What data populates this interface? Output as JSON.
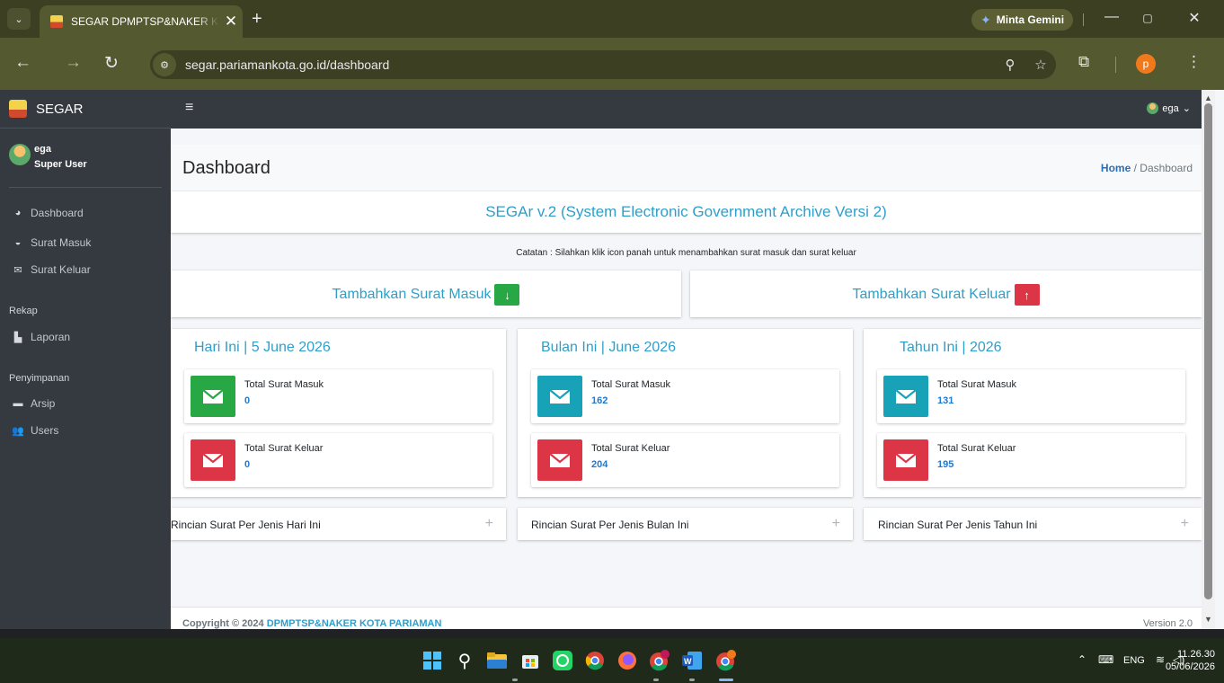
{
  "browser": {
    "tab_title": "SEGAR DPMPTSP&NAKER KOTA PARIAMAN",
    "url": "segar.pariamankota.go.id/dashboard",
    "gemini_label": "Minta Gemini",
    "profile_initial": "p"
  },
  "app": {
    "brand": "SEGAR",
    "user": {
      "name": "ega",
      "role": "Super User"
    },
    "sidebar": {
      "items": [
        {
          "label": "Dashboard",
          "icon": "tachometer-icon"
        },
        {
          "label": "Surat Masuk",
          "icon": "inbox-icon"
        },
        {
          "label": "Surat Keluar",
          "icon": "envelope-icon"
        }
      ],
      "rekap_header": "Rekap",
      "rekap_items": [
        {
          "label": "Laporan",
          "icon": "file-icon"
        }
      ],
      "storage_header": "Penyimpanan",
      "storage_items": [
        {
          "label": "Arsip",
          "icon": "archive-icon"
        },
        {
          "label": "Users",
          "icon": "users-icon"
        }
      ]
    },
    "topnav": {
      "user_label": "ega"
    }
  },
  "main": {
    "title": "Dashboard",
    "breadcrumb": {
      "home": "Home",
      "separator": "/",
      "current": "Dashboard"
    },
    "banner": "SEGAr v.2 (System Electronic Government Archive Versi 2)",
    "note": "Catatan : Silahkan klik icon panah untuk menambahkan surat masuk dan surat keluar",
    "add_in": "Tambahkan Surat Masuk",
    "add_out": "Tambahkan Surat Keluar",
    "panels": [
      {
        "title": "Hari Ini | 5 June 2026",
        "in_label": "Total Surat Masuk",
        "in_value": "0",
        "out_label": "Total Surat Keluar",
        "out_value": "0",
        "detail": "Rincian Surat Per Jenis Hari Ini"
      },
      {
        "title": "Bulan Ini | June 2026",
        "in_label": "Total Surat Masuk",
        "in_value": "162",
        "out_label": "Total Surat Keluar",
        "out_value": "204",
        "detail": "Rincian Surat Per Jenis Bulan Ini"
      },
      {
        "title": "Tahun Ini | 2026",
        "in_label": "Total Surat Masuk",
        "in_value": "131",
        "out_label": "Total Surat Keluar",
        "out_value": "195",
        "detail": "Rincian Surat Per Jenis Tahun Ini"
      }
    ],
    "footer": {
      "copyright": "Copyright © 2024",
      "org": "DPMPTSP&NAKER KOTA PARIAMAN",
      "version": "Version 2.0"
    }
  },
  "colors": {
    "green": "#28a745",
    "red": "#dc3545",
    "teal": "#17a2b8",
    "link": "#2f9fc9"
  },
  "taskbar": {
    "lang": "ENG",
    "time": "11.26.30",
    "date": "05/06/2026"
  }
}
